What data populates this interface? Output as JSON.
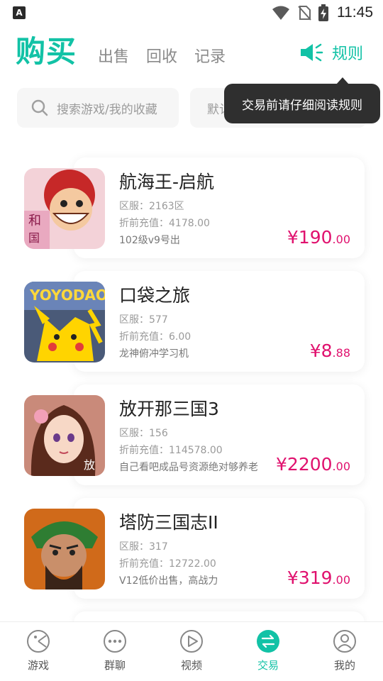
{
  "status": {
    "badge": "A",
    "time": "11:45"
  },
  "header": {
    "active_tab": "购买",
    "tabs": [
      "出售",
      "回收",
      "记录"
    ],
    "rules_label": "规则"
  },
  "search": {
    "placeholder": "搜索游戏/我的收藏"
  },
  "sort": {
    "label": "默认排序"
  },
  "tooltip": "交易前请仔细阅读规则",
  "listings": [
    {
      "title": "航海王-启航",
      "server": "区服：2163区",
      "recharge": "折前充值：4178.00",
      "note": "102级v9号出",
      "price_main": "¥190",
      "price_dec": ".00"
    },
    {
      "title": "口袋之旅",
      "server": "区服：577",
      "recharge": "折前充值：6.00",
      "note": "龙神俯冲学习机",
      "price_main": "¥8",
      "price_dec": ".88"
    },
    {
      "title": "放开那三国3",
      "server": "区服：156",
      "recharge": "折前充值：114578.00",
      "note": "自己看吧成品号资源绝对够养老",
      "price_main": "¥2200",
      "price_dec": ".00"
    },
    {
      "title": "塔防三国志II",
      "server": "区服：317",
      "recharge": "折前充值：12722.00",
      "note": "V12低价出售，高战力",
      "price_main": "¥319",
      "price_dec": ".00"
    }
  ],
  "nav": [
    "游戏",
    "群聊",
    "视频",
    "交易",
    "我的"
  ],
  "colors": {
    "accent": "#12c2a6",
    "price": "#e0116e"
  }
}
